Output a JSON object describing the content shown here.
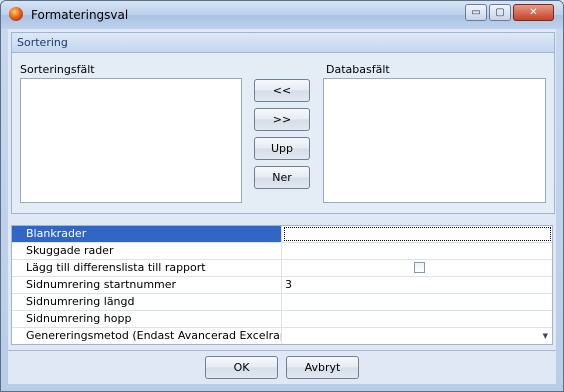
{
  "window": {
    "title": "Formateringsval"
  },
  "titlebar": {
    "minimize": "▭",
    "maximize": "▢",
    "close": "✕"
  },
  "sorting": {
    "header": "Sortering",
    "sort_fields_label": "Sorteringsfält",
    "db_fields_label": "Databasfält",
    "buttons": {
      "move_left": "<<",
      "move_right": ">>",
      "up": "Upp",
      "down": "Ner"
    }
  },
  "properties": {
    "rows": [
      {
        "name": "Blankrader",
        "value": ""
      },
      {
        "name": "Skuggade rader",
        "value": ""
      },
      {
        "name": "Lägg till differenslista till rapport",
        "value": ""
      },
      {
        "name": "Sidnumrering startnummer",
        "value": "3"
      },
      {
        "name": "Sidnumrering längd",
        "value": ""
      },
      {
        "name": "Sidnumrering hopp",
        "value": ""
      },
      {
        "name": "Genereringsmetod (Endast Avancerad Excelrapport)",
        "value": ""
      }
    ],
    "checkbox_checked": false
  },
  "footer": {
    "ok": "OK",
    "cancel": "Avbryt"
  },
  "icons": [
    "app-icon",
    "checkbox-icon",
    "dropdown-arrow-icon"
  ]
}
